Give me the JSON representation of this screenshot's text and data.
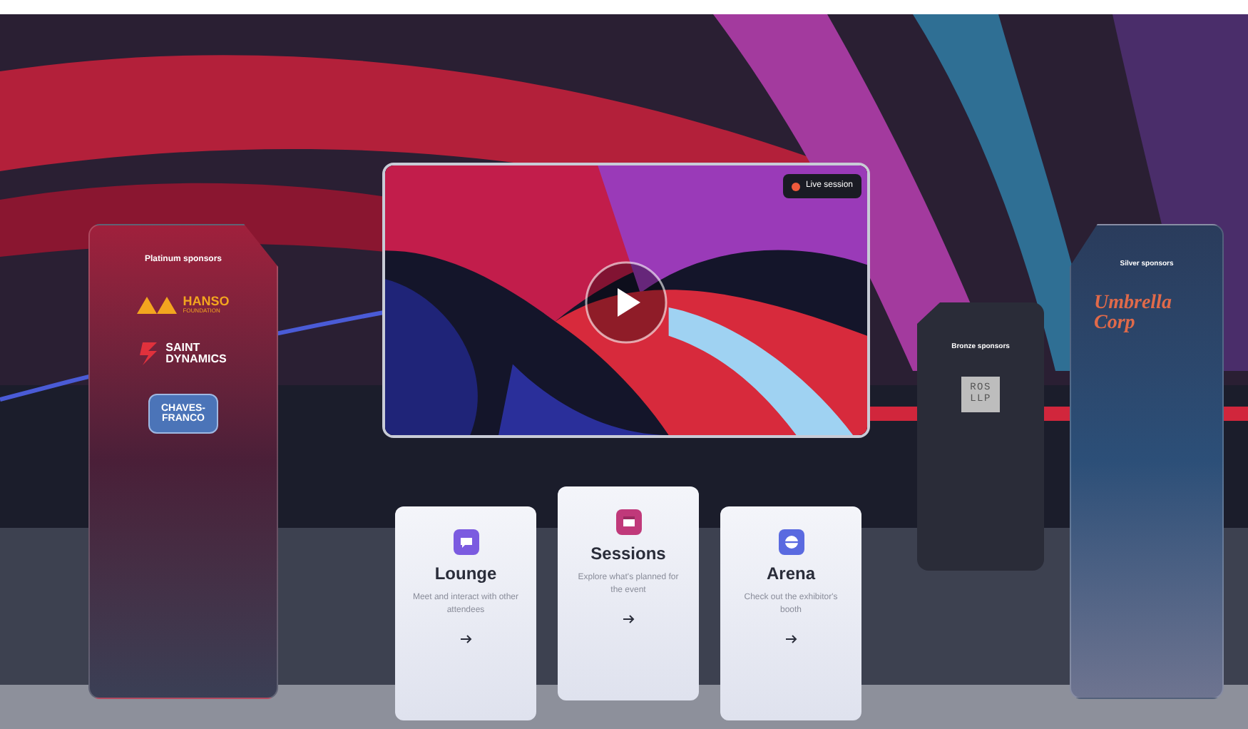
{
  "platinum": {
    "title": "Platinum sponsors",
    "sponsors": [
      {
        "kind": "hanso",
        "name": "HANSO",
        "sub": "FOUNDATION"
      },
      {
        "kind": "saint",
        "name": "SAINT",
        "sub": "DYNAMICS"
      },
      {
        "kind": "chaves",
        "name": "CHAVES-",
        "sub": "FRANCO"
      }
    ]
  },
  "video": {
    "badge": "Live session"
  },
  "bronze": {
    "title": "Bronze sponsors",
    "sponsors": [
      {
        "kind": "box",
        "name": "ROS",
        "sub": "LLP"
      }
    ]
  },
  "silver": {
    "title": "Silver sponsors",
    "sponsors": [
      {
        "kind": "script",
        "name": "Umbrella",
        "sub": "Corp"
      }
    ]
  },
  "cards": [
    {
      "kind": "lounge",
      "title": "Lounge",
      "text": "Meet and interact with other attendees"
    },
    {
      "kind": "sessions",
      "title": "Sessions",
      "text": "Explore what's planned for the event"
    },
    {
      "kind": "arena",
      "title": "Arena",
      "text": "Check out the exhibitor's booth"
    }
  ]
}
